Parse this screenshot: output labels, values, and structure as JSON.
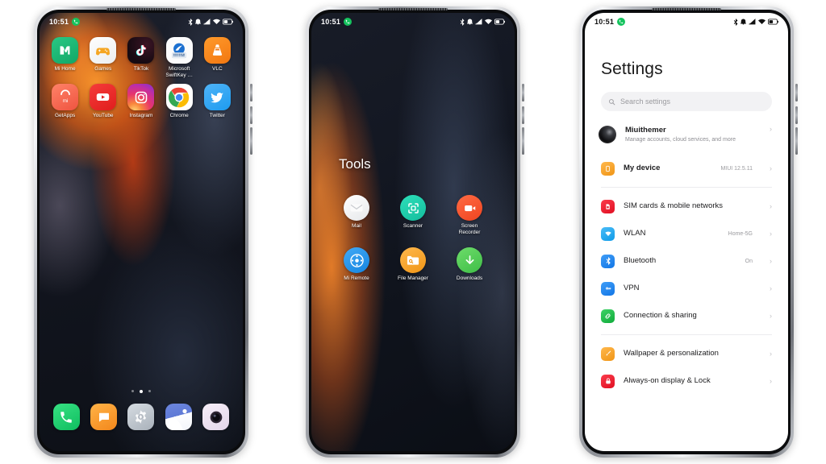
{
  "phones": [
    {
      "id": "home-screen",
      "statusbar": {
        "time": "10:51",
        "icons": [
          "call-badge-icon",
          "bluetooth-icon",
          "alarm-icon",
          "signal-icon",
          "wifi-icon",
          "battery-icon"
        ]
      },
      "rows": [
        [
          {
            "label": "Mi Home",
            "icon": "mi-home-icon",
            "color": "#1bb978"
          },
          {
            "label": "Games",
            "icon": "games-icon",
            "color": "#ffffff"
          },
          {
            "label": "TikTok",
            "icon": "tiktok-icon",
            "color": "#1a0d14"
          },
          {
            "label": "Microsoft SwiftKey …",
            "icon": "swiftkey-icon",
            "color": "#ffffff"
          },
          {
            "label": "VLC",
            "icon": "vlc-icon",
            "color": "#f68012"
          }
        ],
        [
          {
            "label": "GetApps",
            "icon": "getapps-icon",
            "color": "#f4664c"
          },
          {
            "label": "YouTube",
            "icon": "youtube-icon",
            "color": "#ee2a28"
          },
          {
            "label": "Instagram",
            "icon": "instagram-icon",
            "color": "#d6249f"
          },
          {
            "label": "Chrome",
            "icon": "chrome-icon",
            "color": "#ffffff"
          },
          {
            "label": "Twitter",
            "icon": "twitter-icon",
            "color": "#33a1f2"
          }
        ]
      ],
      "page_dots": {
        "count": 3,
        "active_index": 1
      },
      "dock": [
        {
          "label": "Phone",
          "icon": "phone-icon",
          "color": "#1ccb6e"
        },
        {
          "label": "Messages",
          "icon": "messages-icon",
          "color": "#f59b2a"
        },
        {
          "label": "Settings",
          "icon": "settings-gear-icon",
          "color": "#b8bec6"
        },
        {
          "label": "Gallery",
          "icon": "gallery-icon",
          "color": "#5b79d8"
        },
        {
          "label": "Camera",
          "icon": "camera-icon",
          "color": "#efe6f2"
        }
      ]
    },
    {
      "id": "tools-folder",
      "statusbar": {
        "time": "10:51"
      },
      "folder_title": "Tools",
      "rows": [
        [
          {
            "label": "Mail",
            "icon": "mail-icon",
            "color": "#f2f2f2"
          },
          {
            "label": "Scanner",
            "icon": "scanner-icon",
            "color": "#1fc9a8"
          },
          {
            "label": "Screen Recorder",
            "icon": "screen-recorder-icon",
            "color": "#f4512c"
          }
        ],
        [
          {
            "label": "Mi Remote",
            "icon": "mi-remote-icon",
            "color": "#2196f3"
          },
          {
            "label": "File Manager",
            "icon": "file-manager-icon",
            "color": "#f5a623"
          },
          {
            "label": "Downloads",
            "icon": "downloads-icon",
            "color": "#53c356"
          }
        ]
      ]
    },
    {
      "id": "settings-screen",
      "statusbar": {
        "time": "10:51"
      },
      "title": "Settings",
      "search": {
        "placeholder": "Search settings",
        "icon": "search-icon"
      },
      "groups": [
        {
          "items": [
            {
              "title": "Miuithemer",
              "subtitle": "Manage accounts, cloud services, and more",
              "value": "",
              "icon": "account-avatar",
              "color": "#1a1a1a",
              "bold": true
            },
            {
              "title": "My device",
              "subtitle": "",
              "value": "MIUI 12.5.11",
              "icon": "my-device-icon",
              "color": "#f5a623",
              "bold": true
            }
          ]
        },
        {
          "items": [
            {
              "title": "SIM cards & mobile networks",
              "subtitle": "",
              "value": "",
              "icon": "sim-card-icon",
              "color": "#e8192c",
              "bold": false
            },
            {
              "title": "WLAN",
              "subtitle": "",
              "value": "Home-5G",
              "icon": "wifi-icon",
              "color": "#1ca9f0",
              "bold": false
            },
            {
              "title": "Bluetooth",
              "subtitle": "",
              "value": "On",
              "icon": "bluetooth-icon",
              "color": "#1c86f0",
              "bold": false
            },
            {
              "title": "VPN",
              "subtitle": "",
              "value": "",
              "icon": "vpn-key-icon",
              "color": "#1c86f0",
              "bold": false
            },
            {
              "title": "Connection & sharing",
              "subtitle": "",
              "value": "",
              "icon": "connection-sharing-icon",
              "color": "#17bd45",
              "bold": false
            }
          ]
        },
        {
          "items": [
            {
              "title": "Wallpaper & personalization",
              "subtitle": "",
              "value": "",
              "icon": "wallpaper-brush-icon",
              "color": "#f5a623",
              "bold": false
            },
            {
              "title": "Always-on display & Lock",
              "subtitle": "",
              "value": "",
              "icon": "lock-screen-icon",
              "color": "#e8192c",
              "bold": false
            }
          ]
        }
      ],
      "chevron": "›"
    }
  ]
}
